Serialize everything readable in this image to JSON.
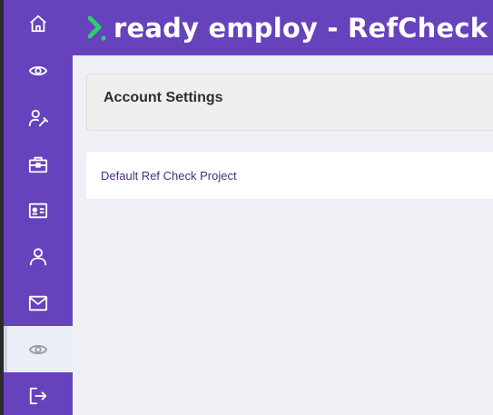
{
  "header": {
    "title": "ready employ - RefCheck",
    "logo_icon": "chevron-logo-icon",
    "brand_color": "#6642bd",
    "logo_accent_color": "#2ecc71"
  },
  "sidebar": {
    "items": [
      {
        "icon": "home-icon",
        "active": false
      },
      {
        "icon": "eye-icon",
        "active": false
      },
      {
        "icon": "user-edit-icon",
        "active": false
      },
      {
        "icon": "briefcase-icon",
        "active": false
      },
      {
        "icon": "id-card-icon",
        "active": false
      },
      {
        "icon": "user-icon",
        "active": false
      },
      {
        "icon": "mail-icon",
        "active": false
      },
      {
        "icon": "eye-icon",
        "active": true
      },
      {
        "icon": "logout-icon",
        "active": false
      }
    ]
  },
  "main": {
    "settings_title": "Account Settings",
    "project_link": "Default Ref Check Project"
  }
}
